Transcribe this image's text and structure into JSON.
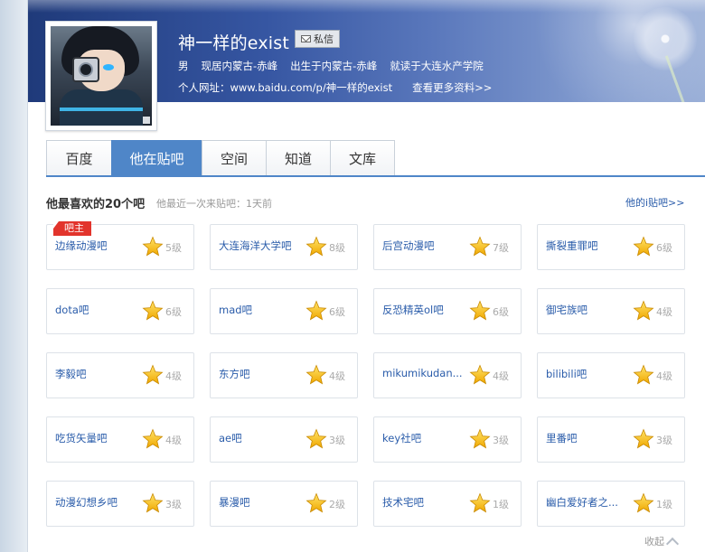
{
  "profile": {
    "name": "神一样的exist",
    "message_button": "私信",
    "gender": "男",
    "residence": "现居内蒙古-赤峰",
    "birthplace": "出生于内蒙古-赤峰",
    "school": "就读于大连水产学院",
    "homepage": "个人网址：www.baidu.com/p/神一样的exist",
    "more_info": "查看更多资料>>"
  },
  "tabs": [
    {
      "label": "百度",
      "active": false
    },
    {
      "label": "他在贴吧",
      "active": true
    },
    {
      "label": "空间",
      "active": false
    },
    {
      "label": "知道",
      "active": false
    },
    {
      "label": "文库",
      "active": false
    }
  ],
  "section": {
    "title": "他最喜欢的20个吧",
    "subtitle": "他最近一次来贴吧：1天前",
    "more_link": "他的i贴吧>>",
    "badge": "吧主"
  },
  "bars": [
    {
      "name": "边缘动漫吧",
      "level": "5级"
    },
    {
      "name": "大连海洋大学吧",
      "level": "8级"
    },
    {
      "name": "后宫动漫吧",
      "level": "7级"
    },
    {
      "name": "撕裂重罪吧",
      "level": "6级"
    },
    {
      "name": "dota吧",
      "level": "6级"
    },
    {
      "name": "mad吧",
      "level": "6级"
    },
    {
      "name": "反恐精英ol吧",
      "level": "6级"
    },
    {
      "name": "御宅族吧",
      "level": "4级"
    },
    {
      "name": "李毅吧",
      "level": "4级"
    },
    {
      "name": "东方吧",
      "level": "4级"
    },
    {
      "name": "mikumikudan...",
      "level": "4级"
    },
    {
      "name": "bilibili吧",
      "level": "4级"
    },
    {
      "name": "吃货矢量吧",
      "level": "4级"
    },
    {
      "name": "ae吧",
      "level": "3级"
    },
    {
      "name": "key社吧",
      "level": "3级"
    },
    {
      "name": "里番吧",
      "level": "3级"
    },
    {
      "name": "动漫幻想乡吧",
      "level": "3级"
    },
    {
      "name": "暴漫吧",
      "level": "2级"
    },
    {
      "name": "技术宅吧",
      "level": "1级"
    },
    {
      "name": "幽白爱好者之...",
      "level": "1级"
    }
  ],
  "footer": {
    "collapse": "收起"
  },
  "colors": {
    "accent": "#4f86c8",
    "link": "#2a5caa",
    "badge": "#e2342c",
    "star": "#f5c400"
  },
  "icons": {
    "message": "mail-icon",
    "level": "star-icon",
    "collapse": "chevron-up-icon"
  }
}
